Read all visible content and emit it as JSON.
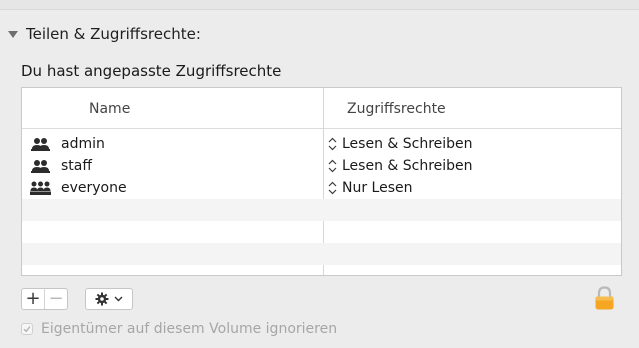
{
  "section": {
    "title": "Teilen & Zugriffsrechte:",
    "summary": "Du hast angepasste Zugriffsrechte"
  },
  "table": {
    "columns": {
      "name": "Name",
      "permissions": "Zugriffsrechte"
    },
    "rows": [
      {
        "name": "admin",
        "icon": "group-icon",
        "permission": "Lesen & Schreiben"
      },
      {
        "name": "staff",
        "icon": "group-icon",
        "permission": "Lesen & Schreiben"
      },
      {
        "name": "everyone",
        "icon": "everyone-icon",
        "permission": "Nur Lesen"
      }
    ]
  },
  "toolbar": {
    "add_label": "+",
    "remove_label": "−",
    "action_icon": "gear-icon",
    "lock_icon": "lock-icon"
  },
  "options": {
    "ignore_ownership_label": "Eigentümer auf diesem Volume ignorieren",
    "ignore_ownership_checked": true,
    "ignore_ownership_enabled": false
  },
  "colors": {
    "background": "#ececec",
    "lock": "#f5a623",
    "disabled_text": "#a6a6a6"
  }
}
